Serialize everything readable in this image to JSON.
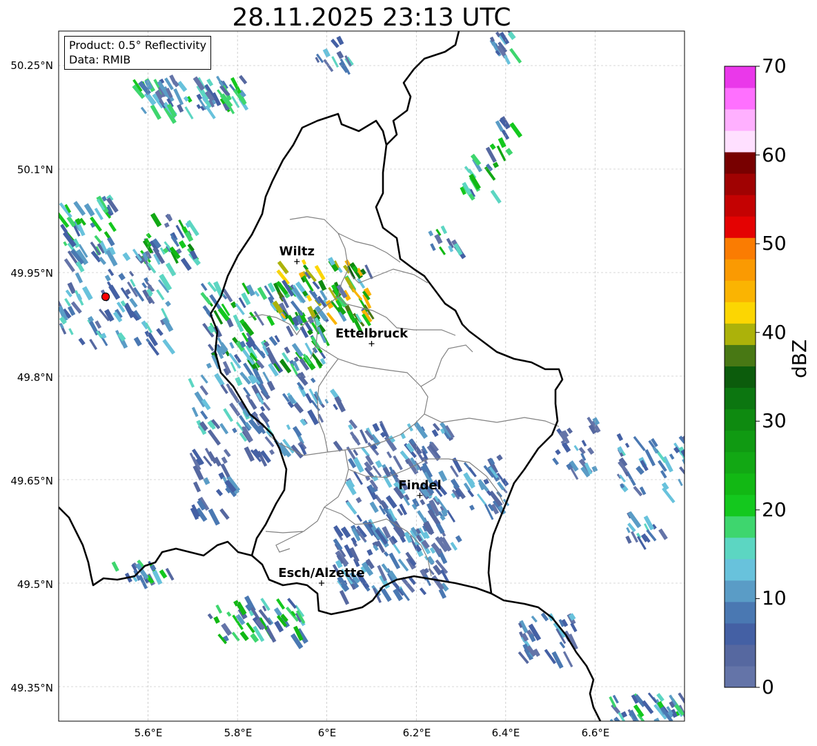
{
  "title": "28.11.2025 23:13 UTC",
  "info": {
    "product": "Product: 0.5° Reflectivity",
    "data_source": "Data: RMIB"
  },
  "map": {
    "lon_range": [
      5.4,
      6.8
    ],
    "lat_range": [
      49.3,
      50.3
    ],
    "x_ticks": [
      "5.6°E",
      "5.8°E",
      "6°E",
      "6.2°E",
      "6.4°E",
      "6.6°E"
    ],
    "y_ticks": [
      "50.25°N",
      "50.1°N",
      "49.95°N",
      "49.8°N",
      "49.65°N",
      "49.5°N",
      "49.35°N"
    ],
    "grid": true,
    "radar_site": {
      "lon": 5.505,
      "lat": 49.915,
      "color": "#ff0000"
    },
    "cities": [
      {
        "name": "Wiltz",
        "lon": 5.933,
        "lat": 49.966
      },
      {
        "name": "Ettelbruck",
        "lon": 6.1,
        "lat": 49.847
      },
      {
        "name": "Findel",
        "lon": 6.208,
        "lat": 49.627
      },
      {
        "name": "Esch/Alzette",
        "lon": 5.988,
        "lat": 49.5
      }
    ]
  },
  "colorbar": {
    "label": "dBZ",
    "range": [
      0,
      70
    ],
    "ticks": [
      "0",
      "10",
      "20",
      "30",
      "40",
      "50",
      "60",
      "70"
    ],
    "colors": [
      "#6474a8",
      "#5668a0",
      "#4460a4",
      "#4a78b2",
      "#5a9cc6",
      "#68c2dc",
      "#5cd6c2",
      "#3ed66e",
      "#14c81e",
      "#12b814",
      "#12a814",
      "#109a12",
      "#0e8a10",
      "#0c7610",
      "#0c5c0c",
      "#487814",
      "#acb20a",
      "#fcd602",
      "#fab402",
      "#fa9a02",
      "#fa7c02",
      "#e40202",
      "#c40202",
      "#a00202",
      "#780000",
      "#ffe0ff",
      "#ffb0ff",
      "#ff70ff",
      "#ea38ea"
    ]
  }
}
